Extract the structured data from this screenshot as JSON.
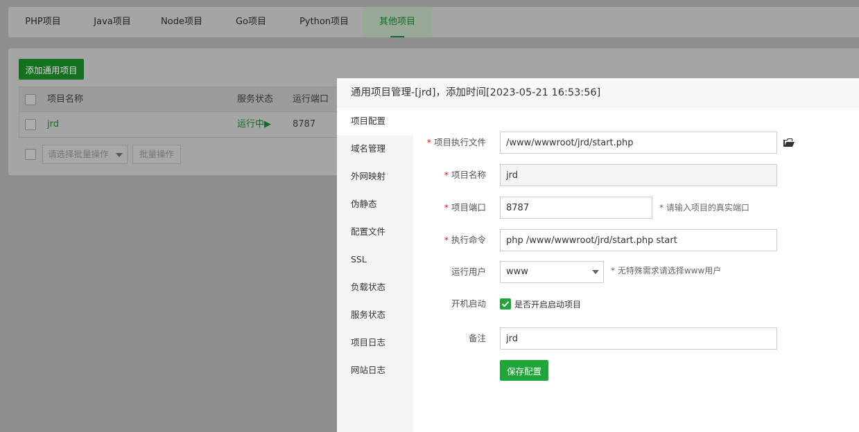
{
  "tabs": [
    {
      "label": "PHP项目"
    },
    {
      "label": "Java项目"
    },
    {
      "label": "Node项目"
    },
    {
      "label": "Go项目"
    },
    {
      "label": "Python项目"
    },
    {
      "label": "其他项目",
      "active": true
    }
  ],
  "toolbar": {
    "add_label": "添加通用项目"
  },
  "table": {
    "headers": [
      "项目名称",
      "服务状态",
      "运行端口"
    ],
    "rows": [
      {
        "name": "jrd",
        "status": "运行中▶",
        "port": "8787"
      }
    ]
  },
  "batch": {
    "select_placeholder": "请选择批量操作",
    "button_label": "批量操作"
  },
  "modal": {
    "title": "通用项目管理-[jrd]，添加时间[2023-05-21 16:53:56]",
    "sidebar": [
      {
        "label": "项目配置",
        "active": true
      },
      {
        "label": "域名管理"
      },
      {
        "label": "外网映射"
      },
      {
        "label": "伪静态"
      },
      {
        "label": "配置文件"
      },
      {
        "label": "SSL"
      },
      {
        "label": "负载状态"
      },
      {
        "label": "服务状态"
      },
      {
        "label": "项目日志"
      },
      {
        "label": "网站日志"
      }
    ],
    "form": {
      "exec_file": {
        "label": "项目执行文件",
        "required_mark": "*",
        "value": "/www/wwwroot/jrd/start.php"
      },
      "name": {
        "label": "项目名称",
        "required_mark": "*",
        "value": "jrd"
      },
      "port": {
        "label": "项目端口",
        "required_mark": "*",
        "value": "8787",
        "hint": "* 请输入项目的真实端口"
      },
      "command": {
        "label": "执行命令",
        "required_mark": "*",
        "value": "php /www/wwwroot/jrd/start.php start"
      },
      "user": {
        "label": "运行用户",
        "value": "www",
        "hint": "* 无特殊需求请选择www用户"
      },
      "autostart": {
        "label": "开机启动",
        "checkbox_label": "是否开启启动项目",
        "checked": true
      },
      "remark": {
        "label": "备注",
        "value": "jrd"
      },
      "save_label": "保存配置"
    }
  },
  "colors": {
    "accent": "#20a53a",
    "required": "#ef0808",
    "overlay_dim": "#8e8e8e"
  }
}
